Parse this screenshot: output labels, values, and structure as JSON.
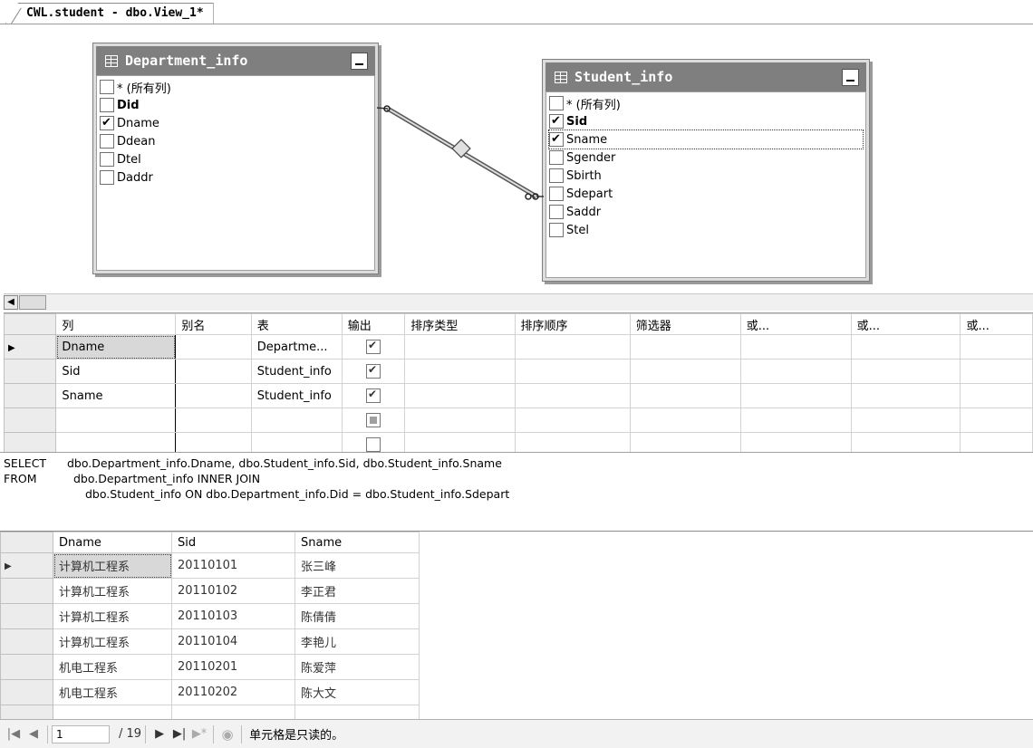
{
  "tab": {
    "title": "CWL.student - dbo.View_1*"
  },
  "diagram": {
    "department": {
      "title": "Department_info",
      "columns": [
        {
          "name": "* (所有列)",
          "checked": false,
          "key": false
        },
        {
          "name": "Did",
          "checked": false,
          "key": true
        },
        {
          "name": "Dname",
          "checked": true,
          "key": false
        },
        {
          "name": "Ddean",
          "checked": false,
          "key": false
        },
        {
          "name": "Dtel",
          "checked": false,
          "key": false
        },
        {
          "name": "Daddr",
          "checked": false,
          "key": false
        }
      ]
    },
    "student": {
      "title": "Student_info",
      "columns": [
        {
          "name": "* (所有列)",
          "checked": false,
          "key": false
        },
        {
          "name": "Sid",
          "checked": true,
          "key": true
        },
        {
          "name": "Sname",
          "checked": true,
          "key": false
        },
        {
          "name": "Sgender",
          "checked": false,
          "key": false
        },
        {
          "name": "Sbirth",
          "checked": false,
          "key": false
        },
        {
          "name": "Sdepart",
          "checked": false,
          "key": false
        },
        {
          "name": "Saddr",
          "checked": false,
          "key": false
        },
        {
          "name": "Stel",
          "checked": false,
          "key": false
        }
      ]
    }
  },
  "criteria": {
    "headers": [
      "列",
      "别名",
      "表",
      "输出",
      "排序类型",
      "排序顺序",
      "筛选器",
      "或...",
      "或...",
      "或..."
    ],
    "rows": [
      {
        "column": "Dname",
        "alias": "",
        "table": "Departme...",
        "output": "on"
      },
      {
        "column": "Sid",
        "alias": "",
        "table": "Student_info",
        "output": "on"
      },
      {
        "column": "Sname",
        "alias": "",
        "table": "Student_info",
        "output": "on"
      },
      {
        "column": "",
        "alias": "",
        "table": "",
        "output": "ind"
      }
    ]
  },
  "sql": {
    "line1_kw": "SELECT",
    "line1": "dbo.Department_info.Dname, dbo.Student_info.Sid, dbo.Student_info.Sname",
    "line2_kw": "FROM",
    "line2": "dbo.Department_info INNER JOIN",
    "line3": "dbo.Student_info ON dbo.Department_info.Did = dbo.Student_info.Sdepart"
  },
  "results": {
    "headers": [
      "Dname",
      "Sid",
      "Sname"
    ],
    "rows": [
      [
        "计算机工程系",
        "20110101",
        "张三峰"
      ],
      [
        "计算机工程系",
        "20110102",
        "李正君"
      ],
      [
        "计算机工程系",
        "20110103",
        "陈倩倩"
      ],
      [
        "计算机工程系",
        "20110104",
        "李艳儿"
      ],
      [
        "机电工程系",
        "20110201",
        "陈爱萍"
      ],
      [
        "机电工程系",
        "20110202",
        "陈大文"
      ]
    ]
  },
  "nav": {
    "current_record": "1",
    "total_records": "/ 19",
    "status": "单元格是只读的。"
  }
}
